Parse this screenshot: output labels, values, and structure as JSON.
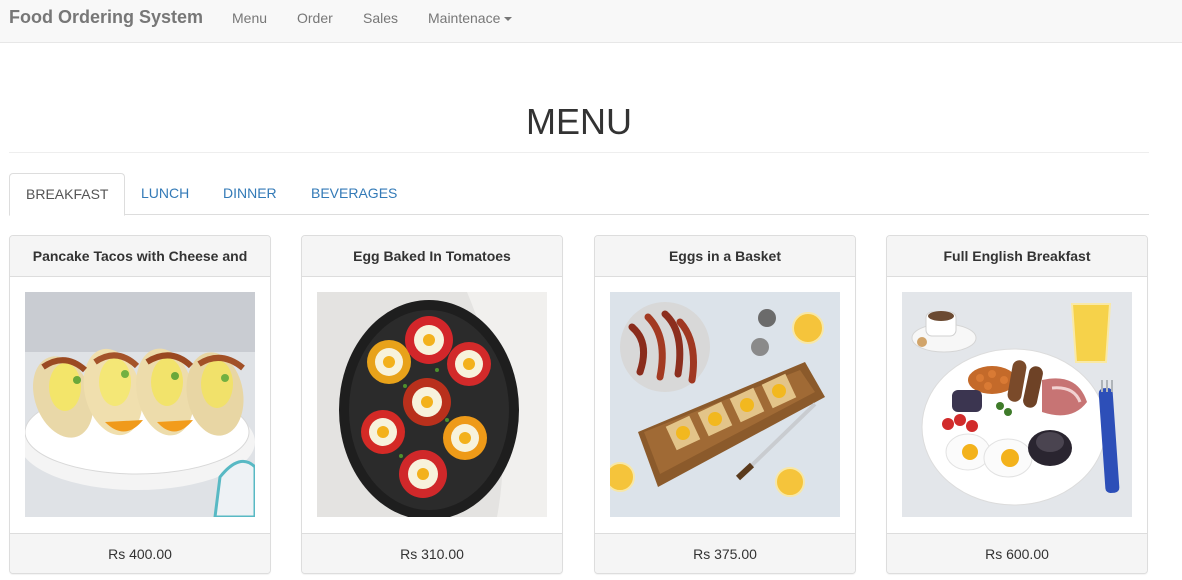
{
  "navbar": {
    "brand": "Food Ordering System",
    "items": [
      {
        "label": "Menu"
      },
      {
        "label": "Order"
      },
      {
        "label": "Sales"
      },
      {
        "label": "Maintenace"
      }
    ]
  },
  "page": {
    "title": "MENU"
  },
  "tabs": [
    {
      "label": "BREAKFAST",
      "active": true
    },
    {
      "label": "LUNCH",
      "active": false
    },
    {
      "label": "DINNER",
      "active": false
    },
    {
      "label": "BEVERAGES",
      "active": false
    }
  ],
  "menu_items": [
    {
      "name": "Pancake Tacos with Cheese and",
      "price": "Rs 400.00",
      "image": "pancake-tacos-photo"
    },
    {
      "name": "Egg Baked In Tomatoes",
      "price": "Rs 310.00",
      "image": "egg-baked-tomatoes-photo"
    },
    {
      "name": "Eggs in a Basket",
      "price": "Rs 375.00",
      "image": "eggs-in-basket-photo"
    },
    {
      "name": "Full English Breakfast",
      "price": "Rs 600.00",
      "image": "full-english-breakfast-photo"
    }
  ],
  "colors": {
    "navbar_bg": "#f8f8f8",
    "link": "#337ab7",
    "panel_bg": "#f5f5f5",
    "border": "#dddddd"
  }
}
